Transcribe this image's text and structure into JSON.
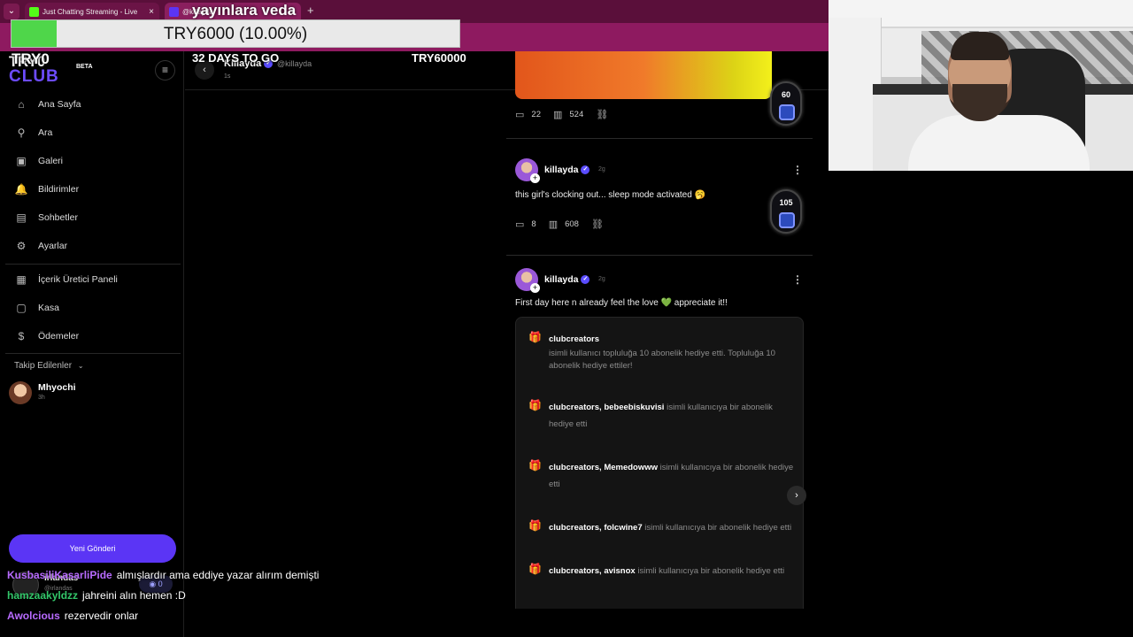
{
  "browser": {
    "tabs": [
      {
        "title": "Just Chatting Streaming - Live",
        "favicon_color": "#53fc18"
      },
      {
        "title": "@killayda",
        "favicon_color": "#5b35f5"
      }
    ],
    "dropdown": "⌄",
    "close": "×",
    "new_tab": "+"
  },
  "overlay": {
    "title": "yayınlara veda",
    "donation_text": "TRY6000 (10.00%)",
    "donation_progress": 0.1,
    "current": "TRY0",
    "days_left": "32 DAYS TO GO",
    "goal": "TRY60000"
  },
  "logo": {
    "line1": "TRY0",
    "line2": "CLUB",
    "beta": "BETA"
  },
  "sidebar": {
    "menu_icon": "≡",
    "items": [
      {
        "label": "Ana Sayfa",
        "icon": "home-icon",
        "glyph": "⌂"
      },
      {
        "label": "Ara",
        "icon": "search-icon",
        "glyph": "⚲"
      },
      {
        "label": "Galeri",
        "icon": "gallery-icon",
        "glyph": "▣"
      },
      {
        "label": "Bildirimler",
        "icon": "bell-icon",
        "glyph": "🔔"
      },
      {
        "label": "Sohbetler",
        "icon": "chat-icon",
        "glyph": "▤"
      },
      {
        "label": "Ayarlar",
        "icon": "gear-icon",
        "glyph": "⚙"
      },
      {
        "label": "İçerik Üretici Paneli",
        "icon": "dashboard-icon",
        "glyph": "▦"
      },
      {
        "label": "Kasa",
        "icon": "vault-icon",
        "glyph": "▢"
      },
      {
        "label": "Ödemeler",
        "icon": "dollar-icon",
        "glyph": "$"
      }
    ],
    "following_header": "Takip Edilenler",
    "following": [
      {
        "name": "Mhyochi",
        "time": "3h"
      }
    ],
    "new_post": "Yeni Gönderi",
    "me": {
      "name": "irlandas",
      "handle": "@irlandas",
      "coins": "0"
    }
  },
  "profile_header": {
    "back": "‹",
    "name": "Killayda",
    "handle": "@killayda",
    "time": "1s"
  },
  "feed": {
    "posts": [
      {
        "comments": "22",
        "views": "524",
        "coin": "60"
      },
      {
        "author": "killayda",
        "time": "2g",
        "text": "this girl's clocking out... sleep mode activated 🥱",
        "comments": "8",
        "views": "608",
        "coin": "105"
      },
      {
        "author": "killayda",
        "time": "2g",
        "text": "First day here n already feel the love 💚 appreciate it!!"
      }
    ],
    "gifts": [
      {
        "user": "clubcreators",
        "target": "",
        "text": "isimli kullanıcı topluluğa 10 abonelik hediye etti. Topluluğa 10 abonelik hediye ettiler!"
      },
      {
        "user": "clubcreators",
        "target": "bebeebiskuvisi",
        "text": "isimli kullanıcıya bir abonelik hediye etti"
      },
      {
        "user": "clubcreators",
        "target": "Memedowww",
        "text": "isimli kullanıcıya bir abonelik hediye etti"
      },
      {
        "user": "clubcreators",
        "target": "folcwine7",
        "text": "isimli kullanıcıya bir abonelik hediye etti"
      },
      {
        "user": "clubcreators",
        "target": "avisnox",
        "text": "isimli kullanıcıya bir abonelik hediye etti"
      }
    ],
    "next": "›",
    "more": "⋮",
    "verified": "✓",
    "gift_glyph": "🎁"
  },
  "chat": [
    {
      "user": "KusbasiliKasarliPide",
      "color": "#b86bff",
      "message": "almışlardır ama eddiye yazar alırım demişti"
    },
    {
      "user": "hamzaakyldzz",
      "color": "#33c76a",
      "message": "jahreini alın hemen :D"
    },
    {
      "user": "Awolcious",
      "color": "#b86bff",
      "message": "rezervedir onlar"
    }
  ]
}
